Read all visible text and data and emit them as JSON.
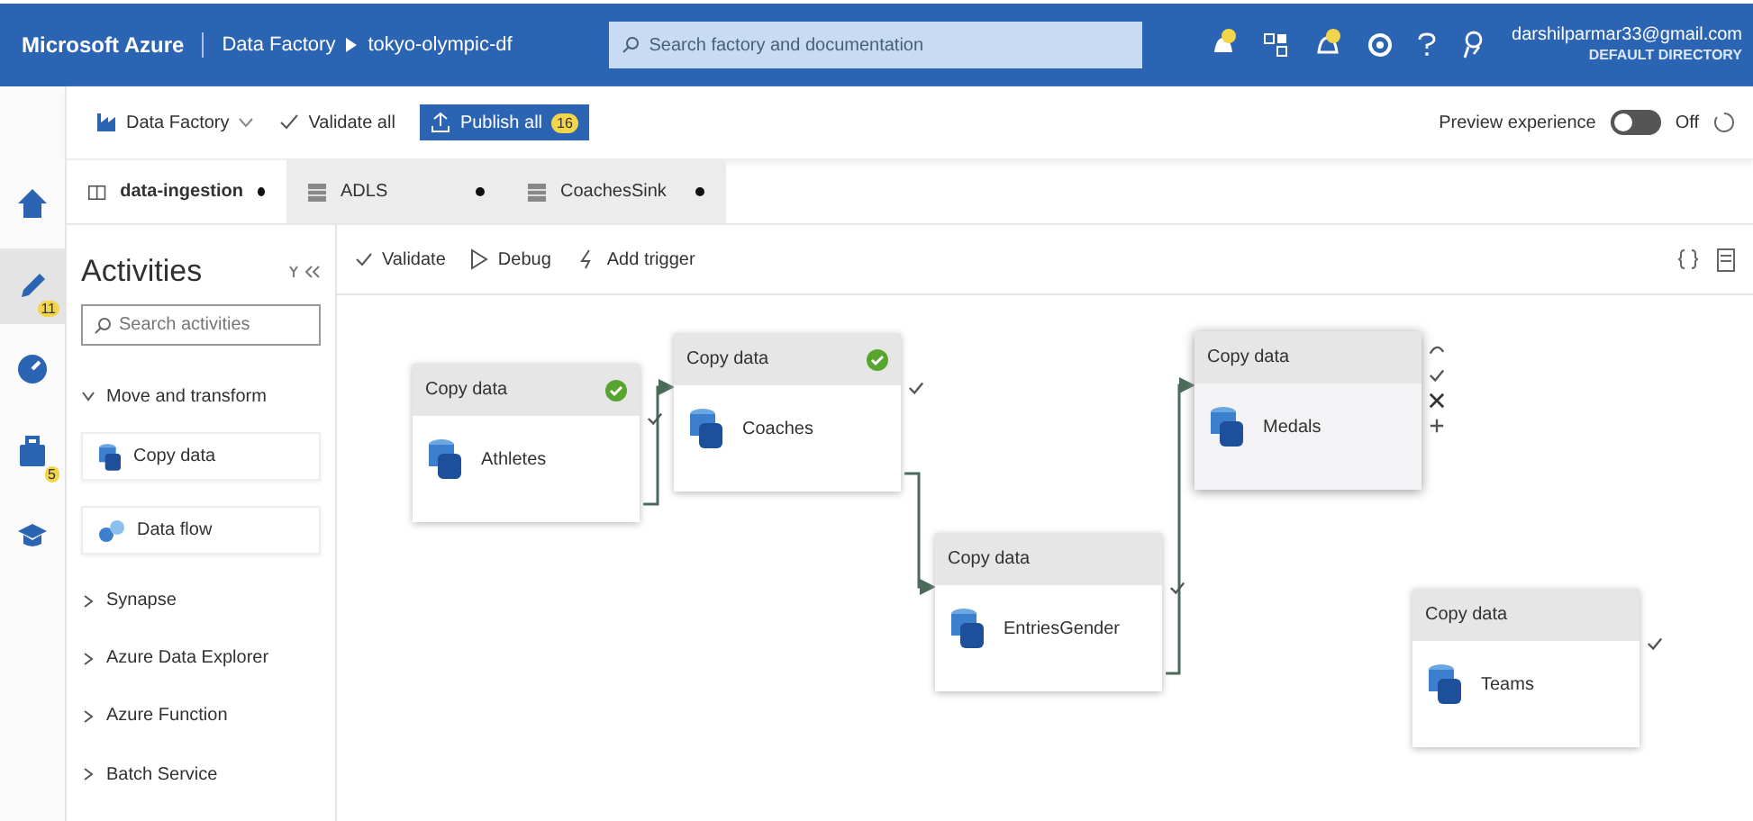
{
  "header": {
    "brand": "Microsoft Azure",
    "breadcrumb": [
      "Data Factory",
      "tokyo-olympic-df"
    ],
    "search": {
      "placeholder": "Search factory and documentation"
    },
    "account": {
      "email": "darshilparmar33@gmail.com",
      "directory": "DEFAULT DIRECTORY"
    }
  },
  "toolbar": {
    "factory": "Data Factory",
    "validate_all": "Validate all",
    "publish": {
      "label": "Publish all",
      "badge": "16"
    },
    "preview": {
      "label": "Preview experience",
      "on": false,
      "state_text": "Off"
    }
  },
  "nav_rail": [
    {
      "kind": "home",
      "selected": false
    },
    {
      "kind": "author",
      "selected": true,
      "badge": "11"
    },
    {
      "kind": "monitor",
      "selected": false
    },
    {
      "kind": "manage",
      "selected": false,
      "badge": "5"
    },
    {
      "kind": "learn",
      "selected": false
    }
  ],
  "tabs": [
    {
      "label": "data-ingestion",
      "kind": "pipeline",
      "selected": true,
      "unsaved": true
    },
    {
      "label": "ADLS",
      "kind": "dataset",
      "selected": false,
      "unsaved": true
    },
    {
      "label": "CoachesSink",
      "kind": "dataset",
      "selected": false,
      "unsaved": true
    }
  ],
  "pipeline_toolbar": [
    {
      "label": "Validate",
      "kind": "validate"
    },
    {
      "label": "Debug",
      "kind": "debug"
    },
    {
      "label": "Add trigger",
      "kind": "trigger"
    }
  ],
  "activities": {
    "title": "Activities",
    "search": {
      "placeholder": "Search activities"
    },
    "groups": [
      {
        "label": "Move and transform",
        "expanded": true,
        "items": [
          {
            "label": "Copy data",
            "kind": "copy"
          },
          {
            "label": "Data flow",
            "kind": "dataflow"
          }
        ]
      },
      {
        "label": "Synapse",
        "expanded": false
      },
      {
        "label": "Azure Data Explorer",
        "expanded": false
      },
      {
        "label": "Azure Function",
        "expanded": false
      },
      {
        "label": "Batch Service",
        "expanded": false
      }
    ]
  },
  "canvas": {
    "nodes": [
      {
        "type": "Copy data",
        "name": "Athletes",
        "succeeded": true,
        "hovered": false,
        "linked_to_next": true
      },
      {
        "type": "Copy data",
        "name": "Coaches",
        "succeeded": true,
        "hovered": false,
        "linked_to_next": true
      },
      {
        "type": "Copy data",
        "name": "EntriesGender",
        "succeeded": false,
        "hovered": false,
        "linked_to_next": true
      },
      {
        "type": "Copy data",
        "name": "Medals",
        "succeeded": false,
        "hovered": true,
        "linked_to_next": false
      },
      {
        "type": "Copy data",
        "name": "Teams",
        "succeeded": false,
        "hovered": false,
        "linked_to_next": false
      }
    ]
  }
}
